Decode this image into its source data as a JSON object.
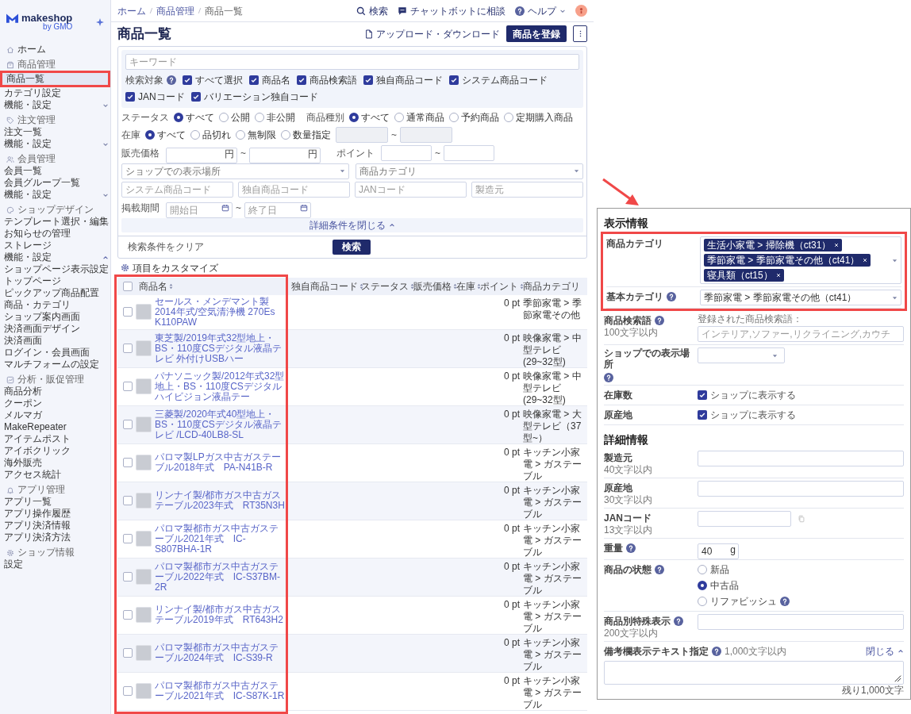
{
  "sidebar": {
    "logo": "makeshop",
    "logo_sub": "by GMO",
    "home": {
      "label": "ホーム",
      "selected": false
    },
    "sections": [
      {
        "title": "商品管理",
        "items": [
          {
            "kind": "link",
            "label": "商品一覧",
            "selected": true
          },
          {
            "kind": "link",
            "label": "カテゴリ設定",
            "selected": false
          },
          {
            "kind": "toggle",
            "label": "機能・設定",
            "selected": false,
            "expanded": false
          }
        ]
      },
      {
        "title": "注文管理",
        "items": [
          {
            "kind": "link",
            "label": "注文一覧",
            "selected": false
          },
          {
            "kind": "toggle",
            "label": "機能・設定",
            "selected": false,
            "expanded": false
          }
        ]
      },
      {
        "title": "会員管理",
        "items": [
          {
            "kind": "link",
            "label": "会員一覧",
            "selected": false
          },
          {
            "kind": "link",
            "label": "会員グループ一覧",
            "selected": false
          },
          {
            "kind": "toggle",
            "label": "機能・設定",
            "selected": false,
            "expanded": false
          }
        ]
      },
      {
        "title": "ショップデザイン",
        "items": [
          {
            "kind": "link",
            "label": "テンプレート選択・編集",
            "selected": false
          },
          {
            "kind": "link",
            "label": "お知らせの管理",
            "selected": false
          },
          {
            "kind": "link",
            "label": "ストレージ",
            "selected": false
          },
          {
            "kind": "toggle",
            "label": "機能・設定",
            "selected": false,
            "expanded": true,
            "children": [
              {
                "kind": "link",
                "label": "ショップページ表示設定",
                "selected": false
              },
              {
                "kind": "link",
                "label": "トップページ",
                "selected": false
              },
              {
                "kind": "link",
                "label": "ピックアップ商品配置",
                "selected": false
              },
              {
                "kind": "link",
                "label": "商品・カテゴリ",
                "selected": false
              },
              {
                "kind": "link",
                "label": "ショップ案内画面",
                "selected": false
              },
              {
                "kind": "link",
                "label": "決済画面デザイン",
                "selected": false
              },
              {
                "kind": "link",
                "label": "決済画面",
                "selected": false
              },
              {
                "kind": "link",
                "label": "ログイン・会員画面",
                "selected": false
              },
              {
                "kind": "link",
                "label": "マルチフォームの設定",
                "selected": false
              }
            ]
          }
        ]
      },
      {
        "title": "分析・販促管理",
        "items": [
          {
            "kind": "link",
            "label": "商品分析",
            "selected": false
          },
          {
            "kind": "link",
            "label": "クーポン",
            "selected": false
          },
          {
            "kind": "link",
            "label": "メルマガ",
            "selected": false
          },
          {
            "kind": "link",
            "label": "MakeRepeater",
            "selected": false
          },
          {
            "kind": "link",
            "label": "アイテムポスト",
            "selected": false
          },
          {
            "kind": "link",
            "label": "アイボクリック",
            "selected": false
          },
          {
            "kind": "link",
            "label": "海外販売",
            "selected": false
          },
          {
            "kind": "link",
            "label": "アクセス統計",
            "selected": false
          }
        ]
      },
      {
        "title": "アプリ管理",
        "items": [
          {
            "kind": "link",
            "label": "アプリ一覧",
            "selected": false
          },
          {
            "kind": "link",
            "label": "アプリ操作履歴",
            "selected": false
          },
          {
            "kind": "link",
            "label": "アプリ決済情報",
            "selected": false
          },
          {
            "kind": "link",
            "label": "アプリ決済方法",
            "selected": false
          }
        ]
      },
      {
        "title": "ショップ情報",
        "items": [
          {
            "kind": "link",
            "label": "設定",
            "selected": false
          }
        ]
      }
    ]
  },
  "header": {
    "breadcrumbs": [
      "ホーム",
      "商品管理",
      "商品一覧"
    ],
    "search": "検索",
    "chatbot": "チャットボットに相談",
    "help": "ヘルプ"
  },
  "page": {
    "title": "商品一覧",
    "upload_download": "アップロード・ダウンロード",
    "register_button": "商品を登録"
  },
  "filter": {
    "keyword_placeholder": "キーワード",
    "targets_label": "検索対象",
    "targets": [
      {
        "label": "すべて選択",
        "checked": true
      },
      {
        "label": "商品名",
        "checked": true
      },
      {
        "label": "商品検索語",
        "checked": true
      },
      {
        "label": "独自商品コード",
        "checked": true
      },
      {
        "label": "システム商品コード",
        "checked": true
      },
      {
        "label": "JANコード",
        "checked": true
      },
      {
        "label": "バリエーション独自コード",
        "checked": true
      }
    ],
    "status": {
      "label": "ステータス",
      "options": [
        {
          "label": "すべて",
          "selected": true
        },
        {
          "label": "公開",
          "selected": false
        },
        {
          "label": "非公開",
          "selected": false
        }
      ]
    },
    "product_type": {
      "label": "商品種別",
      "options": [
        {
          "label": "すべて",
          "selected": true
        },
        {
          "label": "通常商品",
          "selected": false
        },
        {
          "label": "予約商品",
          "selected": false
        },
        {
          "label": "定期購入商品",
          "selected": false
        }
      ]
    },
    "stock": {
      "label": "在庫",
      "options": [
        {
          "label": "すべて",
          "selected": true
        },
        {
          "label": "品切れ",
          "selected": false
        },
        {
          "label": "無制限",
          "selected": false
        },
        {
          "label": "数量指定",
          "selected": false
        }
      ],
      "separator": "~"
    },
    "price": {
      "label": "販売価格",
      "from_unit": "円",
      "separator": "~",
      "to_unit": "円"
    },
    "points": {
      "label": "ポイント",
      "separator": "~"
    },
    "selects": [
      {
        "placeholder": "ショップでの表示場所"
      },
      {
        "placeholder": "商品カテゴリ"
      }
    ],
    "code_fields": [
      {
        "placeholder": "システム商品コード"
      },
      {
        "placeholder": "独自商品コード"
      },
      {
        "placeholder": "JANコード"
      },
      {
        "placeholder": "製造元"
      }
    ],
    "period": {
      "label": "掲載期間",
      "start_placeholder": "開始日",
      "separator": "~",
      "end_placeholder": "終了日"
    },
    "collapse": "詳細条件を閉じる",
    "clear": "検索条件をクリア",
    "search_button": "検索"
  },
  "table": {
    "customize": "項目をカスタマイズ",
    "all_checked": false,
    "columns": [
      {
        "label": "商品名",
        "sortable": true
      },
      {
        "label": "独自商品コード",
        "sortable": true
      },
      {
        "label": "ステータス",
        "sortable": true
      },
      {
        "label": "販売価格",
        "sortable": true
      },
      {
        "label": "在庫",
        "sortable": true
      },
      {
        "label": "ポイント",
        "sortable": true
      },
      {
        "label": "商品カテゴリ",
        "sortable": false
      }
    ],
    "rows": [
      {
        "checked": false,
        "name": "セールス・メンデマント製 2014年式/空気清浄機 270Es K110PAW",
        "point": "0 pt",
        "category": "季節家電 > 季節家電その他"
      },
      {
        "checked": false,
        "name": "東芝製/2019年式32型地上・BS・110度CSデジタル液晶テレビ 外付けUSBハー",
        "point": "0 pt",
        "category": "映像家電 > 中型テレビ(29~32型)"
      },
      {
        "checked": false,
        "name": "パナソニック製/2012年式32型地上・BS・110度CSデジタルハイビジョン液晶テー",
        "point": "0 pt",
        "category": "映像家電 > 中型テレビ(29~32型)"
      },
      {
        "checked": false,
        "name": "三菱製/2020年式40型地上・BS・110度CSデジタル液晶テレビ /LCD-40LB8-SL",
        "point": "0 pt",
        "category": "映像家電 > 大型テレビ（37型~）"
      },
      {
        "checked": false,
        "name": "パロマ製LPガス中古ガステーブル2018年式　PA-N41B-R",
        "point": "0 pt",
        "category": "キッチン小家電 > ガステーブル"
      },
      {
        "checked": false,
        "name": "リンナイ製/都市ガス中古ガステーブル2023年式　RT35N3H",
        "point": "0 pt",
        "category": "キッチン小家電 > ガステーブル"
      },
      {
        "checked": false,
        "name": "パロマ製都市ガス中古ガステーブル2021年式　IC-S807BHA-1R",
        "point": "0 pt",
        "category": "キッチン小家電 > ガステーブル"
      },
      {
        "checked": false,
        "name": "パロマ製都市ガス中古ガステーブル2022年式　IC-S37BM-2R",
        "point": "0 pt",
        "category": "キッチン小家電 > ガステーブル"
      },
      {
        "checked": false,
        "name": "リンナイ製/都市ガス中古ガステーブル2019年式　RT643H2",
        "point": "0 pt",
        "category": "キッチン小家電 > ガステーブル"
      },
      {
        "checked": false,
        "name": "パロマ製都市ガス中古ガステーブル2024年式　IC-S39-R",
        "point": "0 pt",
        "category": "キッチン小家電 > ガステーブル"
      },
      {
        "checked": false,
        "name": "パロマ製都市ガス中古ガステーブル2021年式　IC-S87K-1R",
        "point": "0 pt",
        "category": "キッチン小家電 > ガステーブル"
      }
    ]
  },
  "detail_panel": {
    "sections": [
      {
        "title": "表示情報",
        "rows": [
          {
            "kind": "tags",
            "label": "商品カテゴリ",
            "help": false,
            "tags": [
              "生活小家電 > 掃除機（ct31）",
              "季節家電 > 季節家電その他（ct41）",
              "寝具類（ct15）"
            ]
          },
          {
            "kind": "select",
            "label": "基本カテゴリ",
            "help": true,
            "value": "季節家電 > 季節家電その他（ct41）"
          },
          {
            "kind": "words",
            "label": "商品検索語",
            "help": true,
            "note": "100文字以内",
            "caption": "登録された商品検索語：",
            "placeholder": "インテリア,ソファー,リクライニング,カウチ"
          },
          {
            "kind": "select_small",
            "label": "ショップでの表示場所",
            "help": true
          },
          {
            "kind": "checkbox",
            "label": "在庫数",
            "help": false,
            "option": "ショップに表示する",
            "checked": true
          },
          {
            "kind": "checkbox",
            "label": "原産地",
            "help": false,
            "option": "ショップに表示する",
            "checked": true
          }
        ]
      },
      {
        "title": "詳細情報",
        "rows": [
          {
            "kind": "input",
            "label": "製造元",
            "help": false,
            "note": "40文字以内"
          },
          {
            "kind": "input",
            "label": "原産地",
            "help": false,
            "note": "30文字以内"
          },
          {
            "kind": "code",
            "label": "JANコード",
            "help": false,
            "note": "13文字以内"
          },
          {
            "kind": "unit",
            "label": "重量",
            "help": true,
            "value": "40",
            "unit": "g"
          },
          {
            "kind": "radios",
            "label": "商品の状態",
            "help": true,
            "options": [
              {
                "label": "新品",
                "selected": false,
                "help": false
              },
              {
                "label": "中古品",
                "selected": true,
                "help": false
              },
              {
                "label": "リファビッシュ",
                "selected": false,
                "help": true
              }
            ]
          },
          {
            "kind": "input",
            "label": "商品別特殊表示",
            "help": true,
            "note": "200文字以内"
          },
          {
            "kind": "textarea",
            "label": "備考欄表示テキスト指定",
            "help": true,
            "note": "1,000文字以内",
            "toggle": "閉じる",
            "counter": "残り1,000文字"
          }
        ]
      }
    ]
  },
  "annotations": {
    "sidebar_frame": true,
    "column_frame": true,
    "category_frame": true,
    "arrow": true
  }
}
